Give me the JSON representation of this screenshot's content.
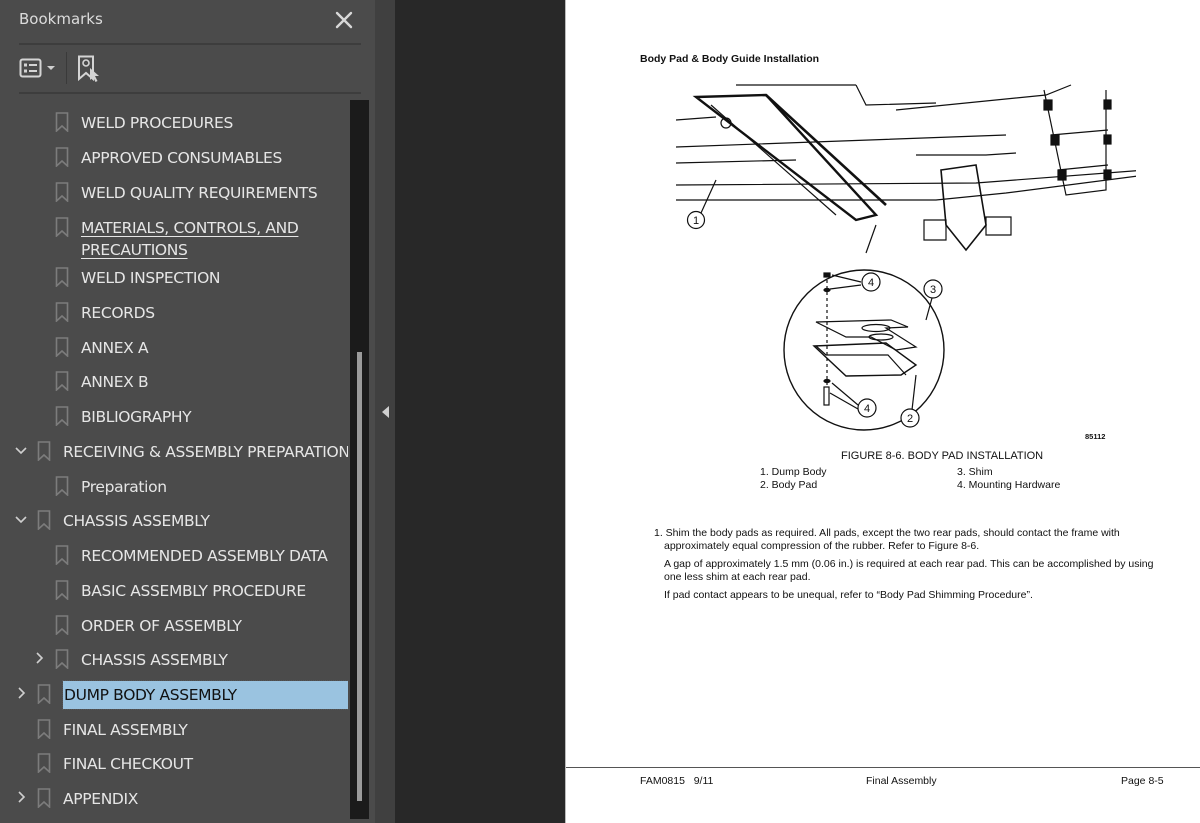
{
  "sidebar": {
    "title": "Bookmarks",
    "close_icon": "close-icon",
    "toolbar": {
      "options_icon": "list-options-icon",
      "find_current_icon": "find-current-bookmark-icon"
    },
    "items": [
      {
        "label": "WELD PROCEDURES",
        "level": 2,
        "expander": "none"
      },
      {
        "label": "APPROVED CONSUMABLES",
        "level": 2,
        "expander": "none"
      },
      {
        "label": "WELD QUALITY REQUIREMENTS",
        "level": 2,
        "expander": "none"
      },
      {
        "label": "MATERIALS, CONTROLS, AND PRECAUTIONS",
        "level": 2,
        "expander": "none",
        "underlined": true
      },
      {
        "label": "WELD INSPECTION",
        "level": 2,
        "expander": "none"
      },
      {
        "label": "RECORDS",
        "level": 2,
        "expander": "none"
      },
      {
        "label": "ANNEX A",
        "level": 2,
        "expander": "none"
      },
      {
        "label": "ANNEX B",
        "level": 2,
        "expander": "none"
      },
      {
        "label": "BIBLIOGRAPHY",
        "level": 2,
        "expander": "none"
      },
      {
        "label": "RECEIVING & ASSEMBLY PREPARATION",
        "level": 1,
        "expander": "expanded"
      },
      {
        "label": "Preparation",
        "level": 2,
        "expander": "none"
      },
      {
        "label": "CHASSIS ASSEMBLY",
        "level": 1,
        "expander": "expanded"
      },
      {
        "label": "RECOMMENDED ASSEMBLY DATA",
        "level": 2,
        "expander": "none"
      },
      {
        "label": "BASIC ASSEMBLY PROCEDURE",
        "level": 2,
        "expander": "none"
      },
      {
        "label": "ORDER OF ASSEMBLY",
        "level": 2,
        "expander": "none"
      },
      {
        "label": "CHASSIS ASSEMBLY",
        "level": 2,
        "expander": "collapsed"
      },
      {
        "label": "DUMP BODY ASSEMBLY",
        "level": 1,
        "expander": "collapsed",
        "selected": true
      },
      {
        "label": "FINAL ASSEMBLY",
        "level": 1,
        "expander": "none"
      },
      {
        "label": "FINAL CHECKOUT",
        "level": 1,
        "expander": "none"
      },
      {
        "label": "APPENDIX",
        "level": 1,
        "expander": "collapsed"
      }
    ],
    "scroll_position": 0.35,
    "selection_color": "#9ac3e0"
  },
  "page": {
    "heading": "Body Pad & Body Guide Installation",
    "figure": {
      "code": "85112",
      "caption": "FIGURE 8-6. BODY PAD INSTALLATION",
      "callouts": [
        "1",
        "2",
        "3",
        "4",
        "4"
      ],
      "legend": [
        "1. Dump Body",
        "2. Body Pad",
        "3. Shim",
        "4. Mounting Hardware"
      ]
    },
    "steps": [
      "1. Shim the body pads as required. All pads, except the two rear pads, should contact the frame with approximately equal compression of the rubber. Refer to Figure 8-6.",
      "A gap of approximately 1.5 mm (0.06 in.) is required at each rear pad. This can be accomplished by using one less shim at each rear pad.",
      "If pad contact appears to be unequal, refer to “Body Pad Shimming Procedure”."
    ],
    "footer": {
      "doc_id": "FAM0815   9/11",
      "section": "Final Assembly",
      "page": "Page 8-5"
    }
  }
}
